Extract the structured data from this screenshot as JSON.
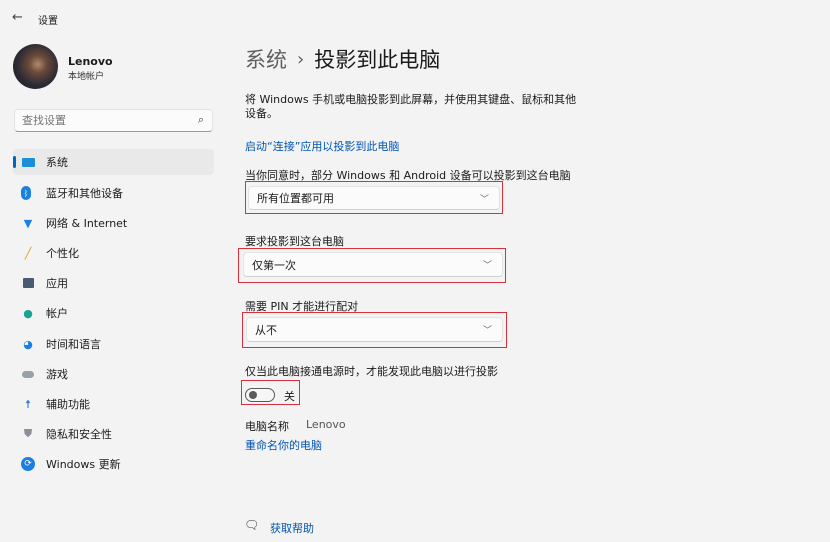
{
  "window": {
    "title": "设置"
  },
  "user": {
    "name": "Lenovo",
    "account_type": "本地帐户"
  },
  "search": {
    "placeholder": "查找设置"
  },
  "sidebar": {
    "items": [
      {
        "label": "系统",
        "icon": "monitor-icon",
        "selected": true
      },
      {
        "label": "蓝牙和其他设备",
        "icon": "bluetooth-icon"
      },
      {
        "label": "网络 & Internet",
        "icon": "wifi-icon"
      },
      {
        "label": "个性化",
        "icon": "brush-icon"
      },
      {
        "label": "应用",
        "icon": "apps-icon"
      },
      {
        "label": "帐户",
        "icon": "person-icon"
      },
      {
        "label": "时间和语言",
        "icon": "globe-clock-icon"
      },
      {
        "label": "游戏",
        "icon": "gamepad-icon"
      },
      {
        "label": "辅助功能",
        "icon": "accessibility-icon"
      },
      {
        "label": "隐私和安全性",
        "icon": "shield-icon"
      },
      {
        "label": "Windows 更新",
        "icon": "update-icon"
      }
    ]
  },
  "header": {
    "parent": "系统",
    "separator": "›",
    "title": "投影到此电脑"
  },
  "main": {
    "description": "将 Windows 手机或电脑投影到此屏幕，并使用其键盘、鼠标和其他设备。",
    "launch_link": "启动“连接”应用以投影到此电脑",
    "availability_label": "当你同意时，部分 Windows 和 Android 设备可以投影到这台电脑",
    "availability_value": "所有位置都可用",
    "ask_label": "要求投影到这台电脑",
    "ask_value": "仅第一次",
    "pin_label": "需要 PIN 才能进行配对",
    "pin_value": "从不",
    "power_label": "仅当此电脑接通电源时，才能发现此电脑以进行投影",
    "power_toggle_state": "关",
    "pc_name_label": "电脑名称",
    "pc_name_value": "Lenovo",
    "rename_link": "重命名你的电脑",
    "help_link": "获取帮助"
  },
  "colors": {
    "accent": "#0067c0",
    "highlight": "#d9303e",
    "background": "#f3f3f3"
  }
}
